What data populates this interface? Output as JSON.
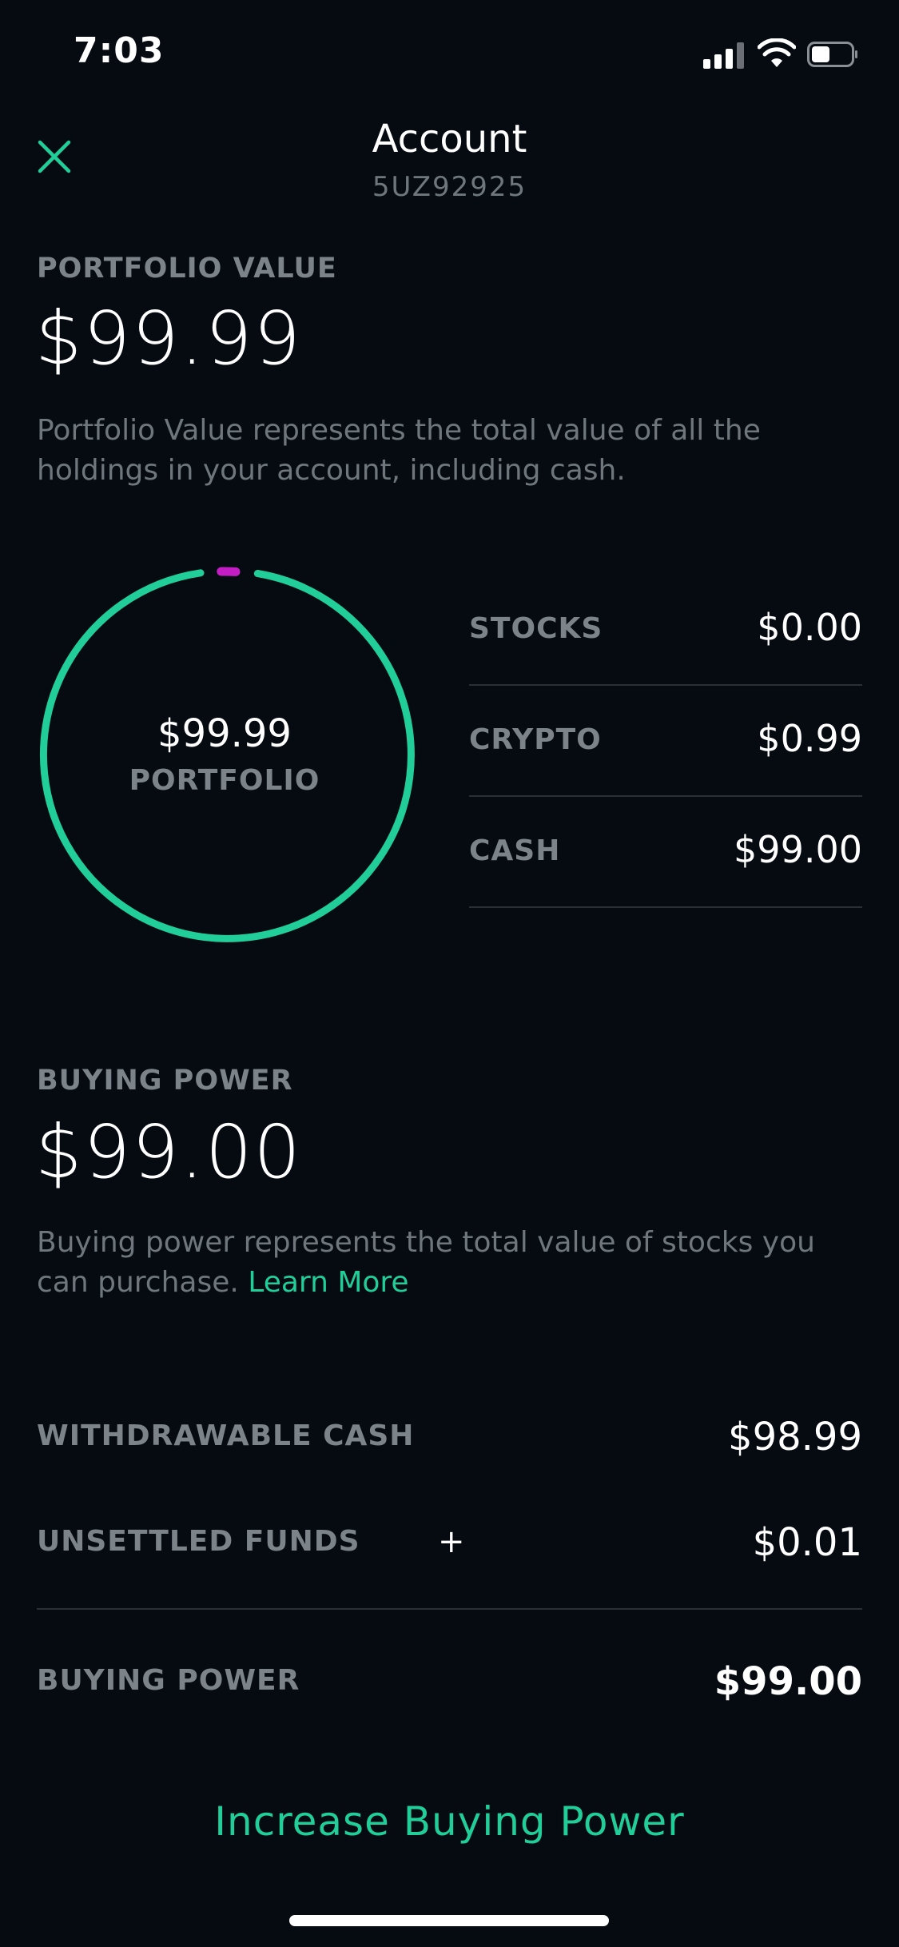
{
  "status_bar": {
    "time": "7:03"
  },
  "header": {
    "title": "Account",
    "account_number": "5UZ92925"
  },
  "portfolio": {
    "label": "PORTFOLIO VALUE",
    "value": "$99.99",
    "description": "Portfolio Value represents the total value of all the holdings in your account, including cash."
  },
  "donut": {
    "center_value": "$99.99",
    "center_label": "PORTFOLIO",
    "segments": [
      {
        "name": "CASH",
        "value": 99.0,
        "color": "#21ce99"
      },
      {
        "name": "CRYPTO",
        "value": 0.99,
        "color": "#c21ec3"
      },
      {
        "name": "STOCKS",
        "value": 0.0,
        "color": "#21ce99"
      }
    ]
  },
  "holdings": [
    {
      "label": "STOCKS",
      "value": "$0.00"
    },
    {
      "label": "CRYPTO",
      "value": "$0.99"
    },
    {
      "label": "CASH",
      "value": "$99.00"
    }
  ],
  "buying_power": {
    "label": "BUYING POWER",
    "value": "$99.00",
    "description": "Buying power represents the total value of stocks you can purchase.",
    "learn_more": "Learn More"
  },
  "summary": {
    "withdrawable_label": "WITHDRAWABLE CASH",
    "withdrawable_value": "$98.99",
    "unsettled_label": "UNSETTLED FUNDS",
    "unsettled_plus": "+",
    "unsettled_value": "$0.01",
    "total_label": "BUYING POWER",
    "total_value": "$99.00"
  },
  "cta": {
    "label": "Increase Buying Power"
  },
  "colors": {
    "accent": "#21ce99",
    "crypto": "#c21ec3",
    "background": "#060b12"
  }
}
